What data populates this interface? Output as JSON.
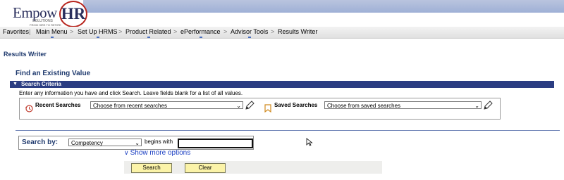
{
  "header": {
    "logo": {
      "main": "Empow",
      "emph": "HR",
      "sub": "SOLUTIONS",
      "tag": "FROM HIRE TO RETIRE"
    }
  },
  "nav": {
    "items": [
      "Favorites",
      "Main Menu",
      "Set Up HRMS",
      "Product Related",
      "ePerformance",
      "Advisor Tools",
      "Results Writer"
    ],
    "separator": ">"
  },
  "page": {
    "title": "Results Writer",
    "subtitle": "Find an Existing Value"
  },
  "criteria": {
    "header": "Search Criteria",
    "info": "Enter any information you have and click Search. Leave fields blank for a list of all values.",
    "recent_label": "Recent Searches",
    "recent_placeholder": "Choose from recent searches",
    "saved_label": "Saved Searches",
    "saved_placeholder": "Choose from saved searches"
  },
  "search": {
    "label": "Search by:",
    "field_value": "Competency",
    "operator": "begins with",
    "input_value": "",
    "more_options": "Show more options"
  },
  "buttons": {
    "search": "Search",
    "clear": "Clear"
  },
  "colors": {
    "title_blue": "#1f3a6e",
    "criteria_bar": "#2b3d82",
    "link_blue": "#1a3ec2",
    "button_yellow": "#fbf3a8"
  }
}
